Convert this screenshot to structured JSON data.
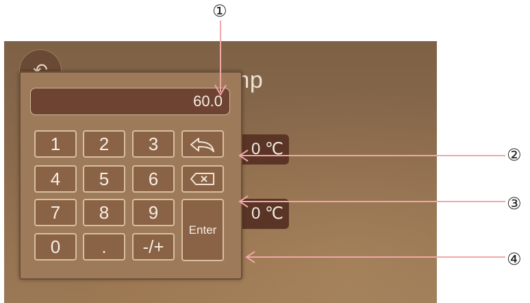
{
  "screen": {
    "title_fragment": "mp",
    "temperature_1": "0 ℃",
    "temperature_2": "0 ℃"
  },
  "keypad": {
    "display_value": "60.0",
    "keys": {
      "one": "1",
      "two": "2",
      "three": "3",
      "four": "4",
      "five": "5",
      "six": "6",
      "seven": "7",
      "eight": "8",
      "nine": "9",
      "zero": "0",
      "dot": ".",
      "sign": "-/+",
      "enter": "Enter"
    }
  },
  "callouts": {
    "c1": "①",
    "c2": "②",
    "c3": "③",
    "c4": "④"
  },
  "colors": {
    "callout_line": "#f2a7a7",
    "keypad_bg": "#9d7a5a",
    "display_bg": "#6e4332"
  },
  "icons": {
    "back": "back-arrow-icon",
    "backspace": "backspace-x-icon",
    "return": "return-arrow-icon"
  }
}
